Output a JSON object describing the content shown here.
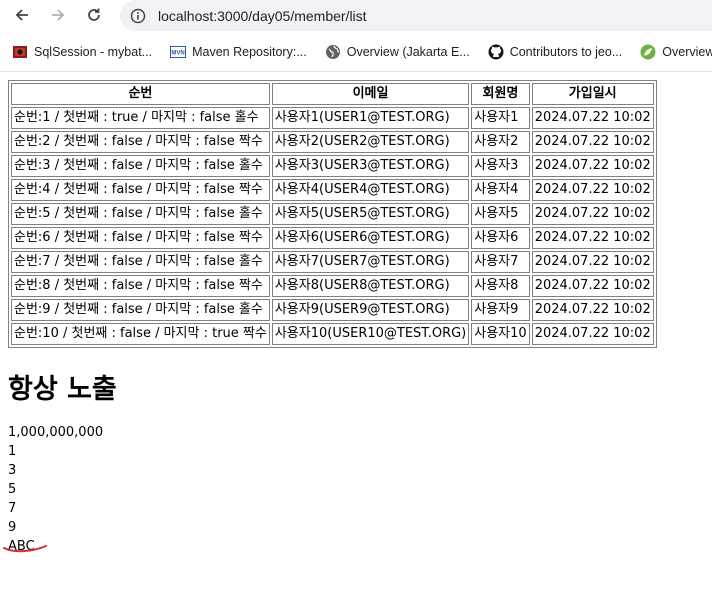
{
  "browser": {
    "url": "localhost:3000/day05/member/list",
    "bookmarks": [
      {
        "label": "SqlSession - mybat...",
        "icon": "mybatis-favicon"
      },
      {
        "label": "Maven Repository:...",
        "icon": "maven-favicon"
      },
      {
        "label": "Overview (Jakarta E...",
        "icon": "globe-icon"
      },
      {
        "label": "Contributors to jeo...",
        "icon": "github-icon"
      },
      {
        "label": "Overview (Sp",
        "icon": "spring-icon"
      }
    ]
  },
  "table": {
    "headers": [
      "순번",
      "이메일",
      "회원명",
      "가입일시"
    ],
    "rows": [
      [
        "순번:1 / 첫번째 : true / 마지막 : false 홀수",
        "사용자1(USER1@TEST.ORG)",
        "사용자1",
        "2024.07.22 10:02"
      ],
      [
        "순번:2 / 첫번째 : false / 마지막 : false 짝수",
        "사용자2(USER2@TEST.ORG)",
        "사용자2",
        "2024.07.22 10:02"
      ],
      [
        "순번:3 / 첫번째 : false / 마지막 : false 홀수",
        "사용자3(USER3@TEST.ORG)",
        "사용자3",
        "2024.07.22 10:02"
      ],
      [
        "순번:4 / 첫번째 : false / 마지막 : false 짝수",
        "사용자4(USER4@TEST.ORG)",
        "사용자4",
        "2024.07.22 10:02"
      ],
      [
        "순번:5 / 첫번째 : false / 마지막 : false 홀수",
        "사용자5(USER5@TEST.ORG)",
        "사용자5",
        "2024.07.22 10:02"
      ],
      [
        "순번:6 / 첫번째 : false / 마지막 : false 짝수",
        "사용자6(USER6@TEST.ORG)",
        "사용자6",
        "2024.07.22 10:02"
      ],
      [
        "순번:7 / 첫번째 : false / 마지막 : false 홀수",
        "사용자7(USER7@TEST.ORG)",
        "사용자7",
        "2024.07.22 10:02"
      ],
      [
        "순번:8 / 첫번째 : false / 마지막 : false 짝수",
        "사용자8(USER8@TEST.ORG)",
        "사용자8",
        "2024.07.22 10:02"
      ],
      [
        "순번:9 / 첫번째 : false / 마지막 : false 홀수",
        "사용자9(USER9@TEST.ORG)",
        "사용자9",
        "2024.07.22 10:02"
      ],
      [
        "순번:10 / 첫번째 : false / 마지막 : true 짝수",
        "사용자10(USER10@TEST.ORG)",
        "사용자10",
        "2024.07.22 10:02"
      ]
    ]
  },
  "heading": "항상 노출",
  "lines": [
    "1,000,000,000",
    "1",
    "3",
    "5",
    "7",
    "9",
    "ABC"
  ],
  "annotation_color": "#d32f2f"
}
